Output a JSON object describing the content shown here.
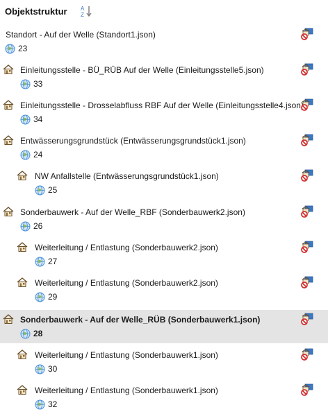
{
  "header": {
    "title": "Objektstruktur",
    "sort_icon": "sort-az-icon"
  },
  "nodes": [
    {
      "label": "Standort - Auf der Welle (Standort1.json)",
      "count": "23",
      "icon": "none",
      "selected": false
    },
    {
      "label": "Einleitungsstelle - BÜ_RÜB Auf der Welle (Einleitungsstelle5.json)",
      "count": "33",
      "icon": "house-icon",
      "selected": false
    },
    {
      "label": "Einleitungsstelle - Drosselabfluss RBF Auf der Welle (Einleitungsstelle4.json)",
      "count": "34",
      "icon": "house-icon",
      "selected": false
    },
    {
      "label": "Entwässerungsgrundstück (Entwässerungsgrundstück1.json)",
      "count": "24",
      "icon": "house-icon",
      "selected": false
    },
    {
      "label": "NW Anfallstelle (Entwässerungsgrundstück1.json)",
      "count": "25",
      "icon": "house-icon",
      "selected": false
    },
    {
      "label": "Sonderbauwerk - Auf der Welle_RBF (Sonderbauwerk2.json)",
      "count": "26",
      "icon": "house-icon",
      "selected": false
    },
    {
      "label": "Weiterleitung / Entlastung (Sonderbauwerk2.json)",
      "count": "27",
      "icon": "house-icon",
      "selected": false
    },
    {
      "label": "Weiterleitung / Entlastung (Sonderbauwerk2.json)",
      "count": "29",
      "icon": "house-icon",
      "selected": false
    },
    {
      "label": "Sonderbauwerk - Auf der Welle_RÜB (Sonderbauwerk1.json)",
      "count": "28",
      "icon": "house-icon",
      "selected": true
    },
    {
      "label": "Weiterleitung / Entlastung (Sonderbauwerk1.json)",
      "count": "30",
      "icon": "house-icon",
      "selected": false
    },
    {
      "label": "Weiterleitung / Entlastung (Sonderbauwerk1.json)",
      "count": "32",
      "icon": "house-icon",
      "selected": false
    }
  ],
  "colors": {
    "selection": "#e4e4e4",
    "house": "#8a6a3a",
    "globe": "#4a90d9",
    "action_red": "#d32f2f",
    "action_blue": "#3a78c8"
  }
}
